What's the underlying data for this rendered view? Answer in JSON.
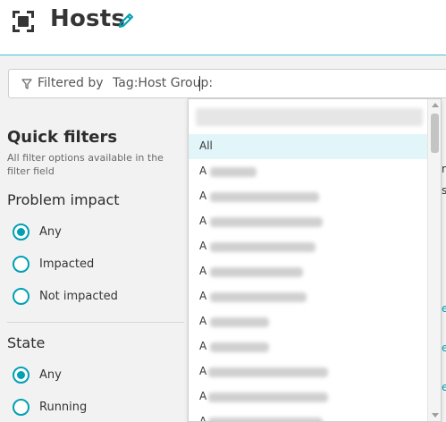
{
  "header": {
    "title": "Hosts",
    "icon": "host-group-icon",
    "edit_icon": "pencil-icon",
    "accent_color": "#46c1d4"
  },
  "filter_bar": {
    "icon": "funnel-icon",
    "label": "Filtered by",
    "token": "Tag:Host Group:"
  },
  "sidebar": {
    "quick_filters": {
      "title": "Quick filters",
      "subtitle": "All filter options available in the filter field"
    },
    "problem_impact": {
      "title": "Problem impact",
      "options": [
        {
          "label": "Any",
          "checked": true
        },
        {
          "label": "Impacted",
          "checked": false
        },
        {
          "label": "Not impacted",
          "checked": false
        }
      ]
    },
    "state": {
      "title": "State",
      "options": [
        {
          "label": "Any",
          "checked": true
        },
        {
          "label": "Running",
          "checked": false
        }
      ]
    }
  },
  "dropdown": {
    "items": [
      {
        "label": "All",
        "selected": true
      },
      {
        "label": "A",
        "selected": false
      },
      {
        "label": "A",
        "selected": false
      },
      {
        "label": "A",
        "selected": false
      },
      {
        "label": "A",
        "selected": false
      },
      {
        "label": "A",
        "selected": false
      },
      {
        "label": "A",
        "selected": false
      },
      {
        "label": "A",
        "selected": false
      },
      {
        "label": "A",
        "selected": false
      },
      {
        "label": "A",
        "selected": false
      },
      {
        "label": "A",
        "selected": false
      },
      {
        "label": "A",
        "selected": false
      }
    ]
  },
  "colors": {
    "accent": "#00a1b2",
    "selected_row": "#e2f6f9"
  }
}
